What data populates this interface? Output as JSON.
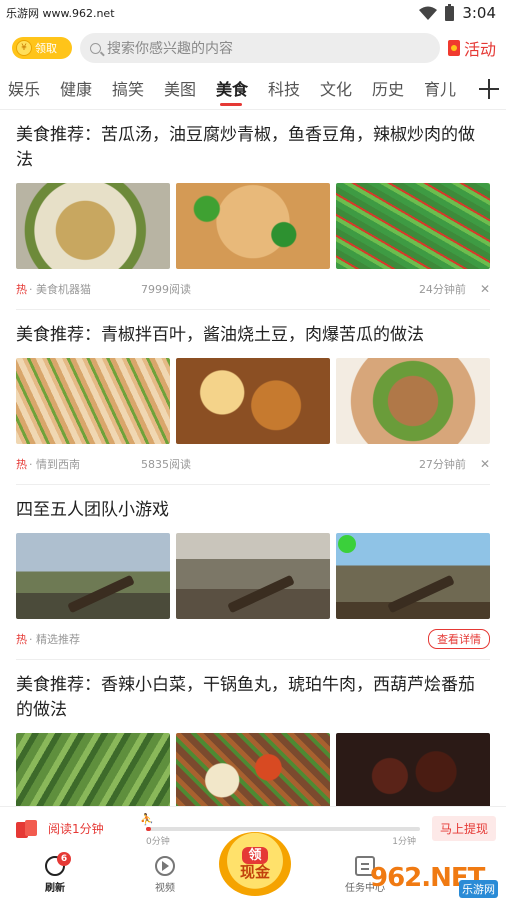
{
  "status_bar": {
    "site_label": "乐游网 www.962.net",
    "time": "3:04"
  },
  "header": {
    "coin_button_label": "领取",
    "coin_symbol": "¥",
    "search_placeholder": "搜索你感兴趣的内容",
    "activity_label": "活动"
  },
  "tabs": [
    {
      "label": "娱乐",
      "active": false
    },
    {
      "label": "健康",
      "active": false
    },
    {
      "label": "搞笑",
      "active": false
    },
    {
      "label": "美图",
      "active": false
    },
    {
      "label": "美食",
      "active": true
    },
    {
      "label": "科技",
      "active": false
    },
    {
      "label": "文化",
      "active": false
    },
    {
      "label": "历史",
      "active": false
    },
    {
      "label": "育儿",
      "active": false
    }
  ],
  "articles": [
    {
      "title": "美食推荐：苦瓜汤，油豆腐炒青椒，鱼香豆角，辣椒炒肉的做法",
      "hot": "热",
      "source": "· 美食机器猫",
      "reads": "7999阅读",
      "time": "24分钟前",
      "close": "✕"
    },
    {
      "title": "美食推荐：青椒拌百叶，酱油烧土豆，肉爆苦瓜的做法",
      "hot": "热",
      "source": "· 情到西南",
      "reads": "5835阅读",
      "time": "27分钟前",
      "close": "✕"
    },
    {
      "title": "四至五人团队小游戏",
      "hot": "热",
      "source": "· 精选推荐",
      "detail_button": "查看详情"
    },
    {
      "title": "美食推荐：香辣小白菜，干锅鱼丸，琥珀牛肉，西葫芦烩番茄的做法"
    }
  ],
  "reading_bar": {
    "label": "阅读1分钟",
    "start_label": "0分钟",
    "end_label": "1分钟",
    "progress": 0.02,
    "withdraw_label": "马上提现"
  },
  "bottom_nav": {
    "refresh_label": "刷新",
    "refresh_badge": "6",
    "video_label": "视频",
    "cash_top": "领",
    "cash_bottom": "现金",
    "tasks_label": "任务中心"
  },
  "watermark": {
    "big": "962.NET",
    "small": "乐游网"
  },
  "colors": {
    "accent": "#e53935",
    "coin": "#ffc419"
  }
}
